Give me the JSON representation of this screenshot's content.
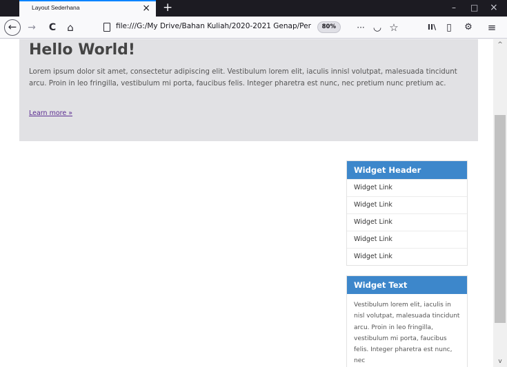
{
  "browser": {
    "tab_title": "Layout Sederhana",
    "tab_close": "×",
    "new_tab": "+",
    "window_controls": {
      "minimize": "–",
      "maximize": "□",
      "close": "×"
    },
    "url": "file:///G:/My Drive/Bahan Kuliah/2020-2021 Genap/Per",
    "zoom": "80%",
    "icons": {
      "back": "←",
      "forward": "→",
      "reload": "C",
      "home": "⌂",
      "more": "···",
      "pocket": "◡",
      "bookmark": "☆",
      "library": "II\\",
      "sidebar": "▯",
      "extension": "⚙",
      "menu": "≡"
    }
  },
  "hero": {
    "title": "Hello World!",
    "text": "Lorem ipsum dolor sit amet, consectetur adipiscing elit. Vestibulum lorem elit, iaculis innisl volutpat, malesuada tincidunt arcu. Proin in leo fringilla, vestibulum mi porta, faucibus felis. Integer pharetra est nunc, nec pretium nunc pretium ac.",
    "link": "Learn more »"
  },
  "widgets": {
    "links_header": "Widget Header",
    "links": [
      "Widget Link",
      "Widget Link",
      "Widget Link",
      "Widget Link",
      "Widget Link"
    ],
    "text_header": "Widget Text",
    "text": "Vestibulum lorem elit, iaculis in nisl volutpat, malesuada tincidunt arcu. Proin in leo fringilla, vestibulum mi porta, faucibus felis. Integer pharetra est nunc, nec"
  },
  "scrollbar": {
    "up": "^",
    "down": "v"
  },
  "colors": {
    "widget_header": "#3d87cb",
    "hero_bg": "#e1e1e4",
    "tab_strip": "#1c1b22",
    "link_visited": "#5b2c91"
  }
}
